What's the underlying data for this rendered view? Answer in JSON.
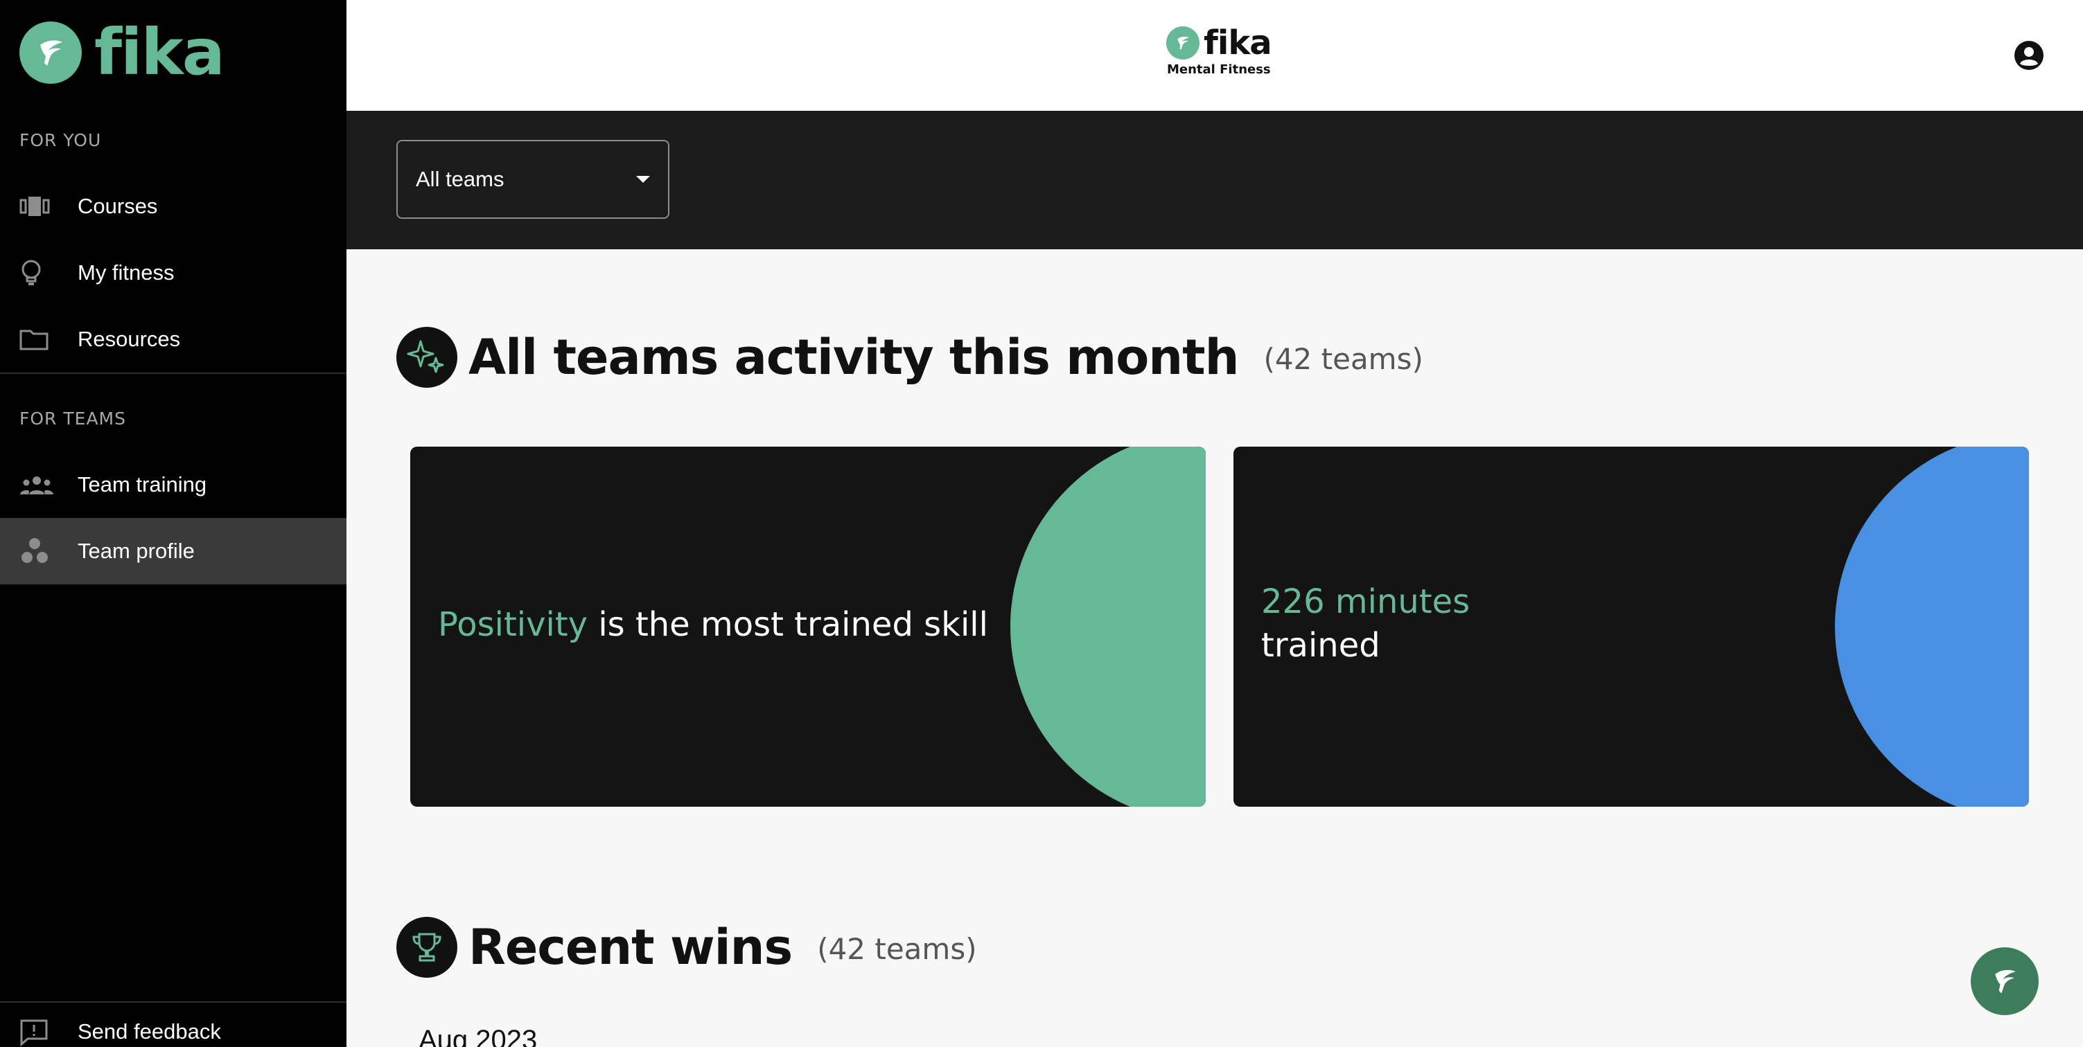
{
  "brand": {
    "name": "fika",
    "subtitle": "Mental Fitness"
  },
  "sidebar": {
    "for_you_label": "FOR YOU",
    "for_teams_label": "FOR TEAMS",
    "items": [
      {
        "label": "Courses",
        "icon": "courses-icon"
      },
      {
        "label": "My fitness",
        "icon": "lightbulb-icon"
      },
      {
        "label": "Resources",
        "icon": "folder-icon"
      },
      {
        "label": "Team training",
        "icon": "group-icon"
      },
      {
        "label": "Team profile",
        "icon": "team-dots-icon",
        "active": true
      }
    ],
    "feedback_label": "Send feedback"
  },
  "filter": {
    "selected": "All teams"
  },
  "activity": {
    "title": "All teams activity this month",
    "count": "(42 teams)",
    "skill_card": {
      "highlight": "Positivity",
      "rest": " is the most trained skill"
    },
    "minutes_card": {
      "highlight": "226 minutes",
      "rest": "trained"
    }
  },
  "wins": {
    "title": "Recent wins",
    "count": "(42 teams)",
    "month": "Aug 2023"
  },
  "colors": {
    "accent": "#66b996",
    "blue": "#4a90e2",
    "sidebar_bg": "#000000",
    "filter_bg": "#1b1b1b",
    "card_bg": "#141414",
    "fab": "#3d7d5c"
  }
}
